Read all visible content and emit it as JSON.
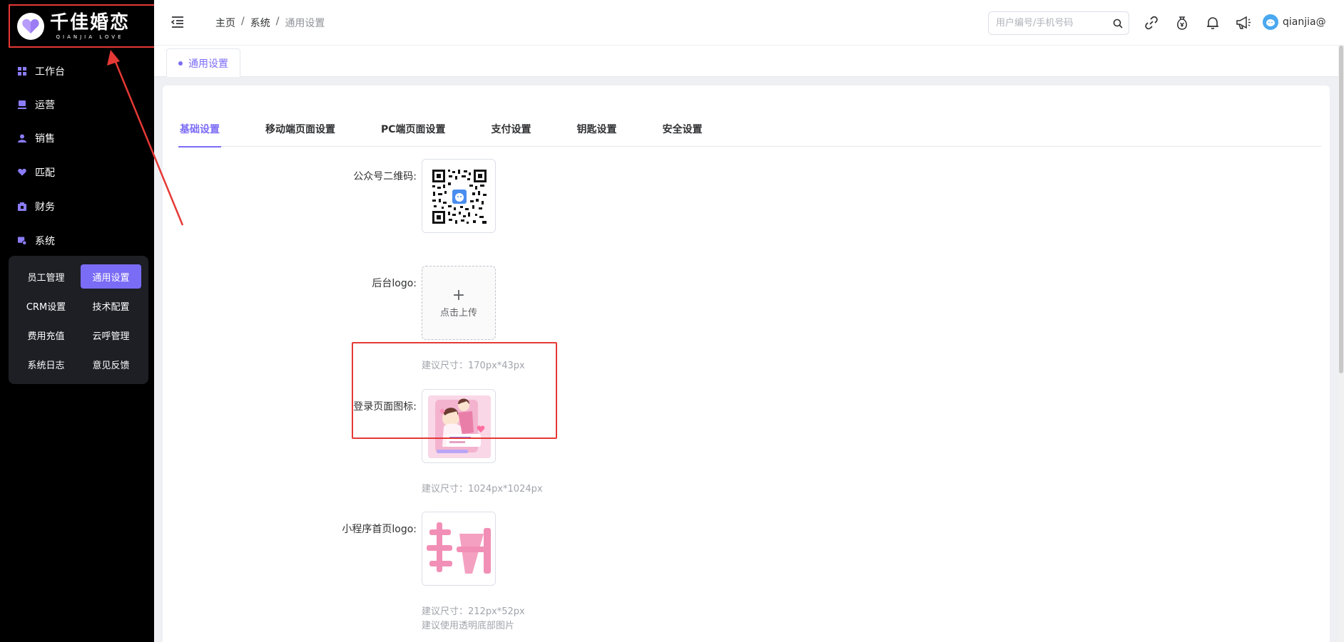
{
  "brand": {
    "name_cn": "千佳婚恋",
    "name_en": "QIANJIA LOVE",
    "accent": "#7b6cf6",
    "highlight": "#e53935"
  },
  "sidebar": {
    "items": [
      {
        "label": "工作台",
        "icon": "dashboard-icon"
      },
      {
        "label": "运营",
        "icon": "operations-icon"
      },
      {
        "label": "销售",
        "icon": "user-icon"
      },
      {
        "label": "匹配",
        "icon": "match-icon"
      },
      {
        "label": "财务",
        "icon": "finance-icon"
      },
      {
        "label": "系统",
        "icon": "system-icon"
      }
    ],
    "submenu": [
      "员工管理",
      "通用设置",
      "CRM设置",
      "技术配置",
      "费用充值",
      "云呼管理",
      "系统日志",
      "意见反馈"
    ],
    "active_sub": "通用设置"
  },
  "header": {
    "breadcrumb": [
      "主页",
      "系统",
      "通用设置"
    ],
    "search_placeholder": "用户编号/手机号码",
    "icons": [
      "link-icon",
      "moneybag-icon",
      "bell-icon",
      "megaphone-icon"
    ],
    "username": "qianjia@"
  },
  "tagbar": {
    "active_tag": "通用设置"
  },
  "tabs": [
    "基础设置",
    "移动端页面设置",
    "PC端页面设置",
    "支付设置",
    "钥匙设置",
    "安全设置"
  ],
  "active_tab": "基础设置",
  "form": {
    "qrcode_label": "公众号二维码:",
    "admin_logo_label": "后台logo:",
    "upload_text": "点击上传",
    "admin_logo_hint": "建议尺寸：170px*43px",
    "login_icon_label": "登录页面图标:",
    "login_icon_hint": "建议尺寸：1024px*1024px",
    "mini_logo_label": "小程序首页logo:",
    "mini_logo_hint": "建议尺寸：212px*52px",
    "mini_logo_hint2": "建议使用透明底部图片"
  }
}
